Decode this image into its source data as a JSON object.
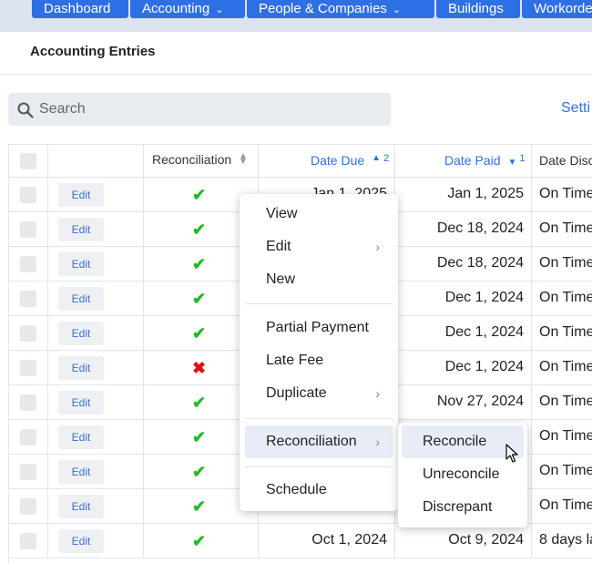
{
  "nav": {
    "items": [
      {
        "label": "Dashboard",
        "has_dropdown": false
      },
      {
        "label": "Accounting",
        "has_dropdown": true
      },
      {
        "label": "People & Companies",
        "has_dropdown": true
      },
      {
        "label": "Buildings",
        "has_dropdown": false
      },
      {
        "label": "Workorde",
        "has_dropdown": false
      }
    ],
    "color": "#2f6fe6"
  },
  "page": {
    "title": "Accounting Entries"
  },
  "search": {
    "placeholder": "Search",
    "value": ""
  },
  "settings_label": "Setti",
  "table": {
    "headers": {
      "reconciliation": "Reconciliation",
      "date_due": "Date Due",
      "date_due_sort": "2",
      "date_paid": "Date Paid",
      "date_paid_sort": "1",
      "date_disc": "Date Disc"
    },
    "edit_label": "Edit",
    "rows": [
      {
        "status": "check",
        "date_due": "Jan 1, 2025",
        "date_paid": "Jan 1, 2025",
        "disc": "On Time"
      },
      {
        "status": "check",
        "date_due": "",
        "date_paid": "Dec 18, 2024",
        "disc": "On Time"
      },
      {
        "status": "check",
        "date_due": "",
        "date_paid": "Dec 18, 2024",
        "disc": "On Time"
      },
      {
        "status": "check",
        "date_due": "",
        "date_paid": "Dec 1, 2024",
        "disc": "On Time"
      },
      {
        "status": "check",
        "date_due": "",
        "date_paid": "Dec 1, 2024",
        "disc": "On Time"
      },
      {
        "status": "x",
        "date_due": "",
        "date_paid": "Dec 1, 2024",
        "disc": "On Time"
      },
      {
        "status": "check",
        "date_due": "",
        "date_paid": "Nov 27, 2024",
        "disc": "On Time"
      },
      {
        "status": "check",
        "date_due": "",
        "date_paid": "",
        "disc": "On Time"
      },
      {
        "status": "check",
        "date_due": "",
        "date_paid": "",
        "disc": "On Time"
      },
      {
        "status": "check",
        "date_due": "",
        "date_paid": "",
        "disc": "On Time"
      },
      {
        "status": "check",
        "date_due": "Oct 1, 2024",
        "date_paid": "Oct 9, 2024",
        "disc": "8 days la"
      }
    ]
  },
  "context_menu": {
    "items": [
      "View",
      "Edit",
      "New",
      "Partial Payment",
      "Late Fee",
      "Duplicate",
      "Reconciliation",
      "Schedule"
    ],
    "submenu": [
      "Reconcile",
      "Unreconcile",
      "Discrepant"
    ]
  },
  "colors": {
    "check": "#22bb22",
    "x": "#dd1111",
    "accent": "#2f6fe6"
  }
}
